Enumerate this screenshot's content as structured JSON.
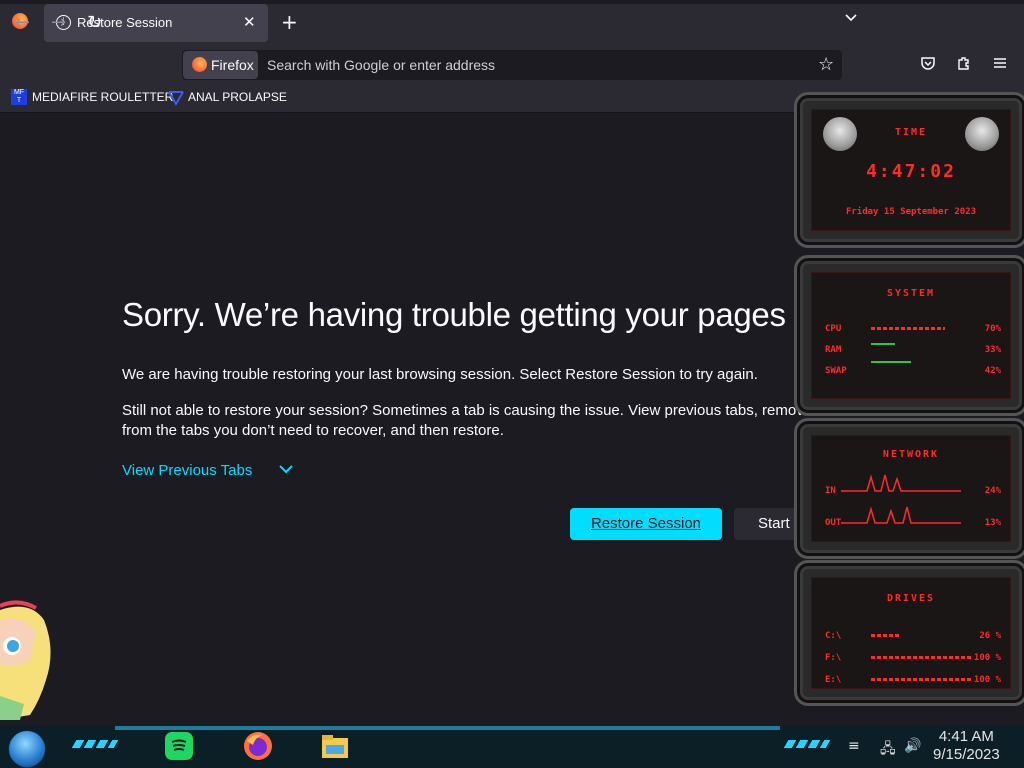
{
  "browser": {
    "tab": {
      "title": "Restore Session",
      "icon": "info-icon"
    },
    "new_tab_label": "+",
    "identity_label": "Firefox",
    "address_placeholder": "Search with Google or enter address"
  },
  "bookmarks": [
    {
      "label": "MEDIAFIRE ROULETTER",
      "icon_text": "MF T"
    },
    {
      "label": "ANAL PROLAPSE"
    }
  ],
  "page": {
    "heading": "Sorry. We’re having trouble getting your pages ba",
    "paragraph1": "We are having trouble restoring your last browsing session. Select Restore Session to try again.",
    "paragraph2": "Still not able to restore your session? Sometimes a tab is causing the issue. View previous tabs, remove t from the tabs you don’t need to recover, and then restore.",
    "view_previous_tabs": "View Previous Tabs",
    "restore_button": "Restore Session",
    "start_button": "Start"
  },
  "gadgets": {
    "time": {
      "title": "TIME",
      "clock": "4:47:02",
      "date": "Friday 15 September 2023"
    },
    "system": {
      "title": "SYSTEM",
      "rows": [
        {
          "label": "CPU",
          "value": "70%",
          "level": 0.7
        },
        {
          "label": "RAM",
          "value": "33%",
          "level": 0.33
        },
        {
          "label": "SWAP",
          "value": "42%",
          "level": 0.42
        }
      ]
    },
    "network": {
      "title": "NETWORK",
      "rows": [
        {
          "label": "IN",
          "value": "24%"
        },
        {
          "label": "OUT",
          "value": "13%"
        }
      ]
    },
    "drives": {
      "title": "DRIVES",
      "rows": [
        {
          "label": "C:\\",
          "value": "26 %",
          "level": 0.26
        },
        {
          "label": "F:\\",
          "value": "100 %",
          "level": 1.0
        },
        {
          "label": "E:\\",
          "value": "100 %",
          "level": 1.0
        }
      ]
    }
  },
  "taskbar": {
    "time": "4:41 AM",
    "date": "9/15/2023",
    "apps": [
      "spotify",
      "firefox",
      "file-explorer"
    ]
  },
  "colors": {
    "accent": "#00ddff",
    "gadget_red": "#ff2a2a",
    "background": "#1c1b22"
  }
}
